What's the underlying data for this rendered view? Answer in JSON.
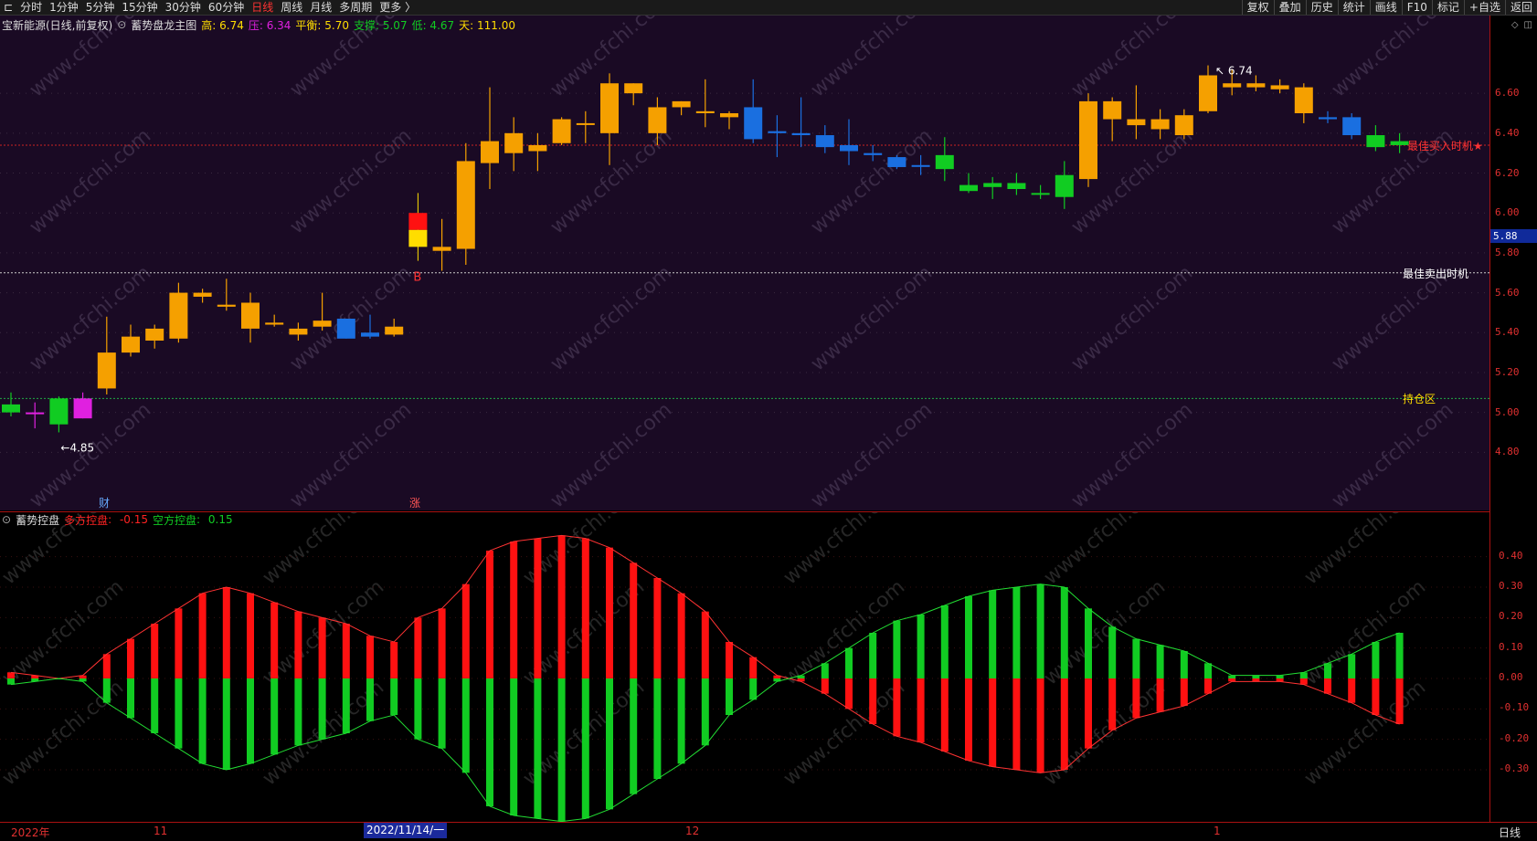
{
  "toolbar": {
    "tabs": [
      "分时",
      "1分钟",
      "5分钟",
      "15分钟",
      "30分钟",
      "60分钟",
      "日线",
      "周线",
      "月线",
      "多周期",
      "更多 〉"
    ],
    "active_tab": "日线",
    "right_buttons": [
      "复权",
      "叠加",
      "历史",
      "统计",
      "画线",
      "F10",
      "标记",
      "+自选",
      "返回"
    ]
  },
  "header": {
    "stock": "宝新能源(日线,前复权)",
    "indicator_name": "蓄势盘龙主图",
    "high_label": "高: 6.74",
    "press_label": "压: 6.34",
    "balance_label": "平衡: 5.70",
    "support_label": "支撑: 5.07",
    "low_label": "低: 4.67",
    "days_label": "天: 111.00"
  },
  "colors": {
    "up_gold": "#f5a000",
    "down_blue": "#1a6fe0",
    "green": "#11cc22",
    "magenta": "#e020e0",
    "red": "#ff1111",
    "yellow": "#ffdd00",
    "axis_red": "#e03030"
  },
  "chart_data": [
    {
      "type": "candlestick",
      "y_ticks": [
        "6.60",
        "6.40",
        "6.20",
        "6.00",
        "5.80",
        "5.60",
        "5.40",
        "5.20",
        "5.00",
        "4.80"
      ],
      "ylim": [
        4.6,
        6.88
      ],
      "current_price": "5.88",
      "high_annotation": "6.74",
      "low_annotation": "←4.85",
      "buy_marker": "B",
      "event_markers": [
        "财",
        "涨"
      ],
      "levels": [
        {
          "label": "最佳买入时机★",
          "value": 6.34,
          "color": "#ff3333"
        },
        {
          "label": "最佳卖出时机",
          "value": 5.7,
          "color": "#ffffff"
        },
        {
          "label": "持仓区",
          "value": 5.07,
          "color": "#ffdd00"
        }
      ],
      "candles": [
        {
          "o": 5.0,
          "h": 5.1,
          "l": 4.98,
          "c": 5.04,
          "col": "green"
        },
        {
          "o": 5.0,
          "h": 5.05,
          "l": 4.92,
          "c": 5.0,
          "col": "magenta"
        },
        {
          "o": 5.07,
          "h": 5.08,
          "l": 4.9,
          "c": 4.94,
          "col": "green"
        },
        {
          "o": 4.97,
          "h": 5.1,
          "l": 4.97,
          "c": 5.07,
          "col": "magenta"
        },
        {
          "o": 5.12,
          "h": 5.48,
          "l": 5.09,
          "c": 5.3,
          "col": "gold"
        },
        {
          "o": 5.3,
          "h": 5.44,
          "l": 5.28,
          "c": 5.38,
          "col": "gold"
        },
        {
          "o": 5.36,
          "h": 5.44,
          "l": 5.32,
          "c": 5.42,
          "col": "gold"
        },
        {
          "o": 5.37,
          "h": 5.65,
          "l": 5.35,
          "c": 5.6,
          "col": "gold"
        },
        {
          "o": 5.58,
          "h": 5.62,
          "l": 5.55,
          "c": 5.6,
          "col": "gold"
        },
        {
          "o": 5.53,
          "h": 5.67,
          "l": 5.51,
          "c": 5.54,
          "col": "gold"
        },
        {
          "o": 5.42,
          "h": 5.6,
          "l": 5.35,
          "c": 5.55,
          "col": "gold"
        },
        {
          "o": 5.44,
          "h": 5.49,
          "l": 5.43,
          "c": 5.45,
          "col": "gold"
        },
        {
          "o": 5.39,
          "h": 5.45,
          "l": 5.36,
          "c": 5.42,
          "col": "gold"
        },
        {
          "o": 5.43,
          "h": 5.6,
          "l": 5.41,
          "c": 5.46,
          "col": "gold"
        },
        {
          "o": 5.47,
          "h": 5.47,
          "l": 5.37,
          "c": 5.37,
          "col": "blue"
        },
        {
          "o": 5.4,
          "h": 5.49,
          "l": 5.37,
          "c": 5.38,
          "col": "blue"
        },
        {
          "o": 5.39,
          "h": 5.47,
          "l": 5.38,
          "c": 5.43,
          "col": "gold"
        },
        {
          "o": 6.0,
          "h": 6.1,
          "l": 5.76,
          "c": 5.83,
          "col": "redyellow"
        },
        {
          "o": 5.81,
          "h": 5.97,
          "l": 5.71,
          "c": 5.83,
          "col": "gold"
        },
        {
          "o": 5.82,
          "h": 6.35,
          "l": 5.74,
          "c": 6.26,
          "col": "gold"
        },
        {
          "o": 6.25,
          "h": 6.63,
          "l": 6.12,
          "c": 6.36,
          "col": "gold"
        },
        {
          "o": 6.3,
          "h": 6.48,
          "l": 6.21,
          "c": 6.4,
          "col": "gold"
        },
        {
          "o": 6.31,
          "h": 6.4,
          "l": 6.21,
          "c": 6.34,
          "col": "gold"
        },
        {
          "o": 6.35,
          "h": 6.48,
          "l": 6.34,
          "c": 6.47,
          "col": "gold"
        },
        {
          "o": 6.45,
          "h": 6.51,
          "l": 6.35,
          "c": 6.45,
          "col": "gold"
        },
        {
          "o": 6.4,
          "h": 6.7,
          "l": 6.24,
          "c": 6.65,
          "col": "gold"
        },
        {
          "o": 6.6,
          "h": 6.65,
          "l": 6.54,
          "c": 6.65,
          "col": "gold"
        },
        {
          "o": 6.4,
          "h": 6.58,
          "l": 6.34,
          "c": 6.53,
          "col": "gold"
        },
        {
          "o": 6.53,
          "h": 6.56,
          "l": 6.49,
          "c": 6.56,
          "col": "gold"
        },
        {
          "o": 6.5,
          "h": 6.67,
          "l": 6.43,
          "c": 6.51,
          "col": "gold"
        },
        {
          "o": 6.48,
          "h": 6.51,
          "l": 6.42,
          "c": 6.5,
          "col": "gold"
        },
        {
          "o": 6.53,
          "h": 6.67,
          "l": 6.35,
          "c": 6.37,
          "col": "blue"
        },
        {
          "o": 6.41,
          "h": 6.49,
          "l": 6.28,
          "c": 6.4,
          "col": "blue"
        },
        {
          "o": 6.4,
          "h": 6.58,
          "l": 6.33,
          "c": 6.39,
          "col": "blue"
        },
        {
          "o": 6.39,
          "h": 6.44,
          "l": 6.3,
          "c": 6.33,
          "col": "blue"
        },
        {
          "o": 6.34,
          "h": 6.47,
          "l": 6.24,
          "c": 6.31,
          "col": "blue"
        },
        {
          "o": 6.3,
          "h": 6.34,
          "l": 6.26,
          "c": 6.29,
          "col": "blue"
        },
        {
          "o": 6.28,
          "h": 6.29,
          "l": 6.22,
          "c": 6.23,
          "col": "blue"
        },
        {
          "o": 6.24,
          "h": 6.29,
          "l": 6.19,
          "c": 6.24,
          "col": "blue"
        },
        {
          "o": 6.22,
          "h": 6.38,
          "l": 6.16,
          "c": 6.29,
          "col": "green"
        },
        {
          "o": 6.11,
          "h": 6.2,
          "l": 6.1,
          "c": 6.14,
          "col": "green"
        },
        {
          "o": 6.13,
          "h": 6.18,
          "l": 6.07,
          "c": 6.15,
          "col": "green"
        },
        {
          "o": 6.12,
          "h": 6.2,
          "l": 6.09,
          "c": 6.15,
          "col": "green"
        },
        {
          "o": 6.1,
          "h": 6.14,
          "l": 6.07,
          "c": 6.1,
          "col": "green"
        },
        {
          "o": 6.08,
          "h": 6.26,
          "l": 6.02,
          "c": 6.19,
          "col": "green"
        },
        {
          "o": 6.17,
          "h": 6.6,
          "l": 6.13,
          "c": 6.56,
          "col": "gold"
        },
        {
          "o": 6.47,
          "h": 6.58,
          "l": 6.36,
          "c": 6.56,
          "col": "gold"
        },
        {
          "o": 6.44,
          "h": 6.64,
          "l": 6.37,
          "c": 6.47,
          "col": "gold"
        },
        {
          "o": 6.42,
          "h": 6.52,
          "l": 6.37,
          "c": 6.47,
          "col": "gold"
        },
        {
          "o": 6.39,
          "h": 6.52,
          "l": 6.37,
          "c": 6.49,
          "col": "gold"
        },
        {
          "o": 6.51,
          "h": 6.74,
          "l": 6.5,
          "c": 6.69,
          "col": "gold"
        },
        {
          "o": 6.63,
          "h": 6.72,
          "l": 6.59,
          "c": 6.65,
          "col": "gold"
        },
        {
          "o": 6.63,
          "h": 6.69,
          "l": 6.61,
          "c": 6.65,
          "col": "gold"
        },
        {
          "o": 6.62,
          "h": 6.67,
          "l": 6.6,
          "c": 6.64,
          "col": "gold"
        },
        {
          "o": 6.5,
          "h": 6.65,
          "l": 6.45,
          "c": 6.63,
          "col": "gold"
        },
        {
          "o": 6.47,
          "h": 6.51,
          "l": 6.45,
          "c": 6.48,
          "col": "blue"
        },
        {
          "o": 6.48,
          "h": 6.5,
          "l": 6.37,
          "c": 6.39,
          "col": "blue"
        },
        {
          "o": 6.39,
          "h": 6.44,
          "l": 6.31,
          "c": 6.33,
          "col": "green"
        },
        {
          "o": 6.34,
          "h": 6.4,
          "l": 6.3,
          "c": 6.36,
          "col": "green"
        }
      ]
    },
    {
      "type": "bar",
      "title": "蓄势控盘",
      "y_ticks": [
        "0.40",
        "0.30",
        "0.20",
        "0.10",
        "0.00",
        "-0.10",
        "-0.20",
        "-0.30"
      ],
      "ylim": [
        -0.45,
        0.48
      ],
      "series": [
        {
          "name": "多方控盘",
          "current": "-0.15",
          "values": [
            0.02,
            0.01,
            0.0,
            0.01,
            0.08,
            0.13,
            0.18,
            0.23,
            0.28,
            0.3,
            0.28,
            0.25,
            0.22,
            0.2,
            0.18,
            0.14,
            0.12,
            0.2,
            0.23,
            0.31,
            0.42,
            0.45,
            0.46,
            0.47,
            0.46,
            0.43,
            0.38,
            0.33,
            0.28,
            0.22,
            0.12,
            0.07,
            0.01,
            -0.01,
            -0.05,
            -0.1,
            -0.15,
            -0.19,
            -0.21,
            -0.24,
            -0.27,
            -0.29,
            -0.3,
            -0.31,
            -0.3,
            -0.23,
            -0.17,
            -0.13,
            -0.11,
            -0.09,
            -0.05,
            -0.01,
            -0.01,
            -0.01,
            -0.02,
            -0.05,
            -0.08,
            -0.12,
            -0.15
          ]
        },
        {
          "name": "空方控盘",
          "current": "0.15",
          "values": [
            -0.02,
            -0.01,
            0.0,
            -0.01,
            -0.08,
            -0.13,
            -0.18,
            -0.23,
            -0.28,
            -0.3,
            -0.28,
            -0.25,
            -0.22,
            -0.2,
            -0.18,
            -0.14,
            -0.12,
            -0.2,
            -0.23,
            -0.31,
            -0.42,
            -0.45,
            -0.46,
            -0.47,
            -0.46,
            -0.43,
            -0.38,
            -0.33,
            -0.28,
            -0.22,
            -0.12,
            -0.07,
            -0.01,
            0.01,
            0.05,
            0.1,
            0.15,
            0.19,
            0.21,
            0.24,
            0.27,
            0.29,
            0.3,
            0.31,
            0.3,
            0.23,
            0.17,
            0.13,
            0.11,
            0.09,
            0.05,
            0.01,
            0.01,
            0.01,
            0.02,
            0.05,
            0.08,
            0.12,
            0.15
          ]
        }
      ]
    }
  ],
  "dates": {
    "year_label": "2022年",
    "nov_label": "11",
    "cursor_date": "2022/11/14/一",
    "dec_label": "12",
    "jan_label": "1"
  },
  "period_label": "日线",
  "watermark": "www.cfchi.com"
}
